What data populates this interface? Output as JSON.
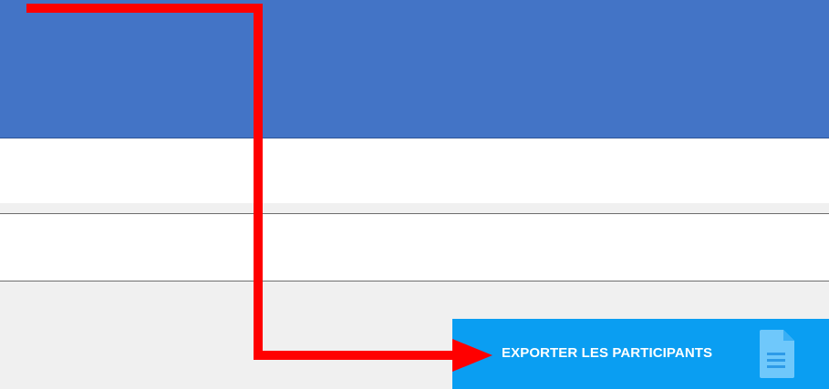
{
  "export_button": {
    "label": "EXPORTER LES PARTICIPANTS",
    "icon": "document-icon"
  },
  "colors": {
    "header": "#4374c6",
    "button": "#0a9ef2",
    "annotation_arrow": "#ff0000",
    "background": "#f0f0f0"
  }
}
